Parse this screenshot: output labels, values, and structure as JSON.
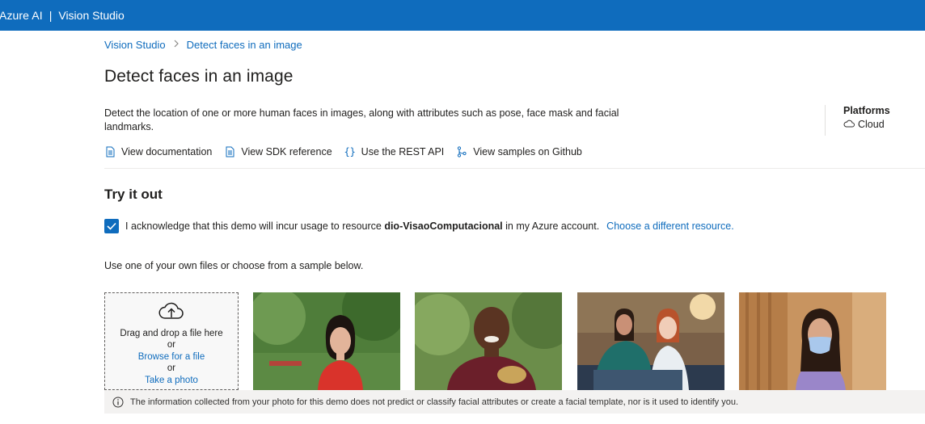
{
  "header": {
    "brand": "Azure AI",
    "separator": "|",
    "product": "Vision Studio"
  },
  "breadcrumb": {
    "root": "Vision Studio",
    "current": "Detect faces in an image"
  },
  "page": {
    "title": "Detect faces in an image",
    "description": "Detect the location of one or more human faces in images, along with attributes such as pose, face mask and facial landmarks."
  },
  "platforms": {
    "title": "Platforms",
    "value": "Cloud",
    "icon": "cloud-icon"
  },
  "links": [
    {
      "label": "View documentation",
      "icon": "document-icon"
    },
    {
      "label": "View SDK reference",
      "icon": "document-icon"
    },
    {
      "label": "Use the REST API",
      "icon": "braces-icon"
    },
    {
      "label": "View samples on Github",
      "icon": "branch-icon"
    }
  ],
  "try_it_out": {
    "title": "Try it out",
    "ack_prefix": "I acknowledge that this demo will incur usage to resource",
    "resource": "dio-VisaoComputacional",
    "ack_suffix": "in my Azure account.",
    "choose_link": "Choose a different resource.",
    "checked": true,
    "hint": "Use one of your own files or choose from a sample below."
  },
  "upload": {
    "icon": "cloud-upload-icon",
    "drag_text": "Drag and drop a file here",
    "or1": "or",
    "browse": "Browse for a file",
    "or2": "or",
    "photo": "Take a photo"
  },
  "samples": [
    {
      "subject": "woman-red-dress",
      "background": "#4f7d3a"
    },
    {
      "subject": "man-maroon-shirt",
      "background": "#6b8d4a"
    },
    {
      "subject": "two-women-office",
      "background": "#7a6048"
    },
    {
      "subject": "woman-face-mask",
      "background": "#c89460"
    }
  ],
  "info": {
    "icon": "info-icon",
    "text": "The information collected from your photo for this demo does not predict or classify facial attributes or create a facial template, nor is it used to identify you."
  },
  "colors": {
    "accent": "#0f6cbd",
    "text": "#201f1e"
  }
}
